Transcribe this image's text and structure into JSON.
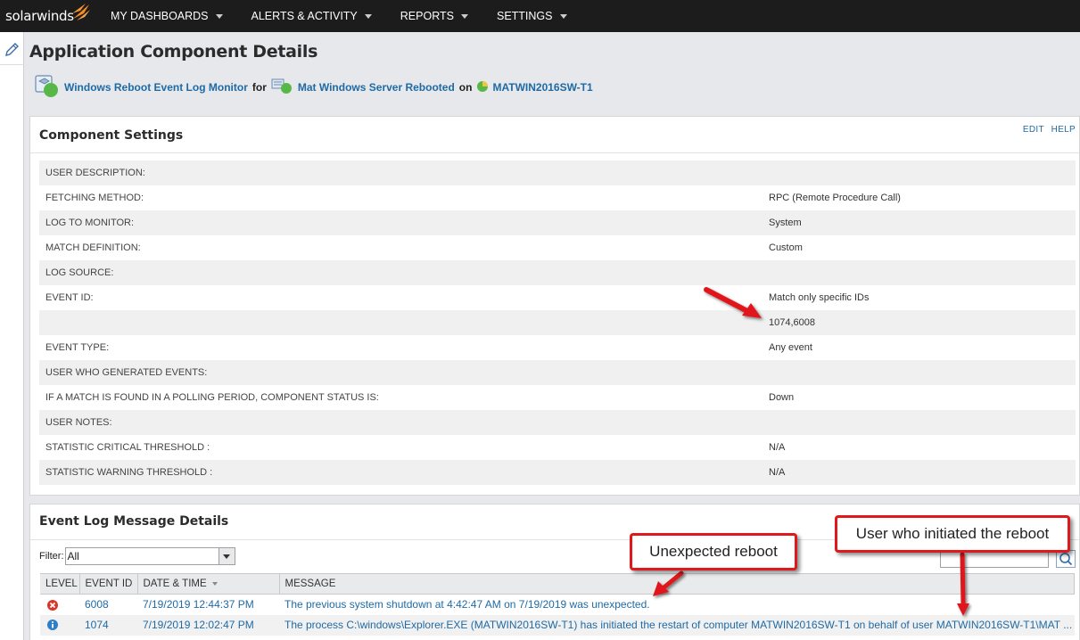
{
  "brand": {
    "logo_text": "solarwinds"
  },
  "nav": {
    "items": [
      {
        "label": "MY DASHBOARDS"
      },
      {
        "label": "ALERTS & ACTIVITY"
      },
      {
        "label": "REPORTS"
      },
      {
        "label": "SETTINGS"
      }
    ]
  },
  "page": {
    "title": "Application Component Details",
    "breadcrumb": {
      "component": "Windows Reboot Event Log Monitor",
      "for_word": "for",
      "application": "Mat Windows Server Rebooted",
      "on_word": "on",
      "node": "MATWIN2016SW-T1"
    }
  },
  "component_settings": {
    "title": "Component Settings",
    "edit_label": "EDIT",
    "help_label": "HELP",
    "rows": [
      {
        "label": "USER DESCRIPTION:",
        "value": ""
      },
      {
        "label": "FETCHING METHOD:",
        "value": "RPC (Remote Procedure Call)"
      },
      {
        "label": "LOG TO MONITOR:",
        "value": "System"
      },
      {
        "label": "MATCH DEFINITION:",
        "value": "Custom"
      },
      {
        "label": "LOG SOURCE:",
        "value": ""
      },
      {
        "label": "EVENT ID:",
        "value": "Match only specific IDs"
      },
      {
        "label": "",
        "value": "1074,6008"
      },
      {
        "label": "EVENT TYPE:",
        "value": "Any event"
      },
      {
        "label": "USER WHO GENERATED EVENTS:",
        "value": ""
      },
      {
        "label": "IF A MATCH IS FOUND IN A POLLING PERIOD, COMPONENT STATUS IS:",
        "value": "Down"
      },
      {
        "label": "USER NOTES:",
        "value": ""
      },
      {
        "label": "STATISTIC CRITICAL THRESHOLD :",
        "value": "N/A"
      },
      {
        "label": "STATISTIC WARNING THRESHOLD :",
        "value": "N/A"
      }
    ]
  },
  "event_log": {
    "title": "Event Log Message Details",
    "filter_label": "Filter:",
    "filter_value": "All",
    "columns": [
      "LEVEL",
      "EVENT ID",
      "DATE & TIME",
      "MESSAGE"
    ],
    "rows": [
      {
        "level": "error-icon",
        "event_id": "6008",
        "datetime": "7/19/2019 12:44:37 PM",
        "message": "The previous system shutdown at 4:42:47 AM on 7/19/2019 was unexpected."
      },
      {
        "level": "info-icon",
        "event_id": "1074",
        "datetime": "7/19/2019 12:02:47 PM",
        "message": "The process C:\\windows\\Explorer.EXE (MATWIN2016SW-T1) has initiated the restart of computer MATWIN2016SW-T1 on behalf of user MATWIN2016SW-T1\\MAT ..."
      }
    ]
  },
  "annotations": {
    "unexpected": "Unexpected reboot",
    "user": "User who initiated the reboot"
  },
  "colors": {
    "nav_bg": "#1c1c1c",
    "link": "#1f6aa5",
    "callout_border": "#e0181b",
    "brand_orange": "#f68b1f"
  }
}
